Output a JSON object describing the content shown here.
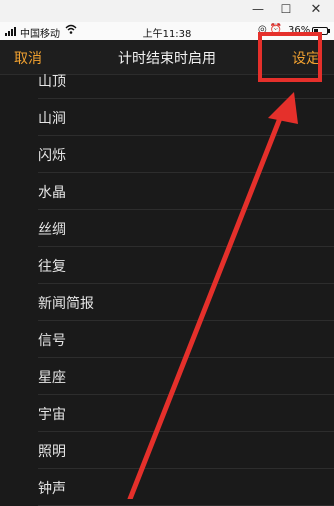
{
  "window": {
    "minimize_icon": "minimize-icon",
    "maximize_icon": "maximize-icon",
    "close_icon": "close-icon"
  },
  "status_bar": {
    "carrier": "中国移动",
    "time": "上午11:38",
    "battery": "36%",
    "battery_level": 0.36
  },
  "nav": {
    "cancel": "取消",
    "title": "计时结束时启用",
    "set": "设定"
  },
  "sounds": [
    "山顶",
    "山涧",
    "闪烁",
    "水晶",
    "丝绸",
    "往复",
    "新闻简报",
    "信号",
    "星座",
    "宇宙",
    "照明",
    "钟声"
  ],
  "colors": {
    "accent": "#f0a030",
    "annotation": "#e5302b",
    "background": "#1a1a1a"
  }
}
